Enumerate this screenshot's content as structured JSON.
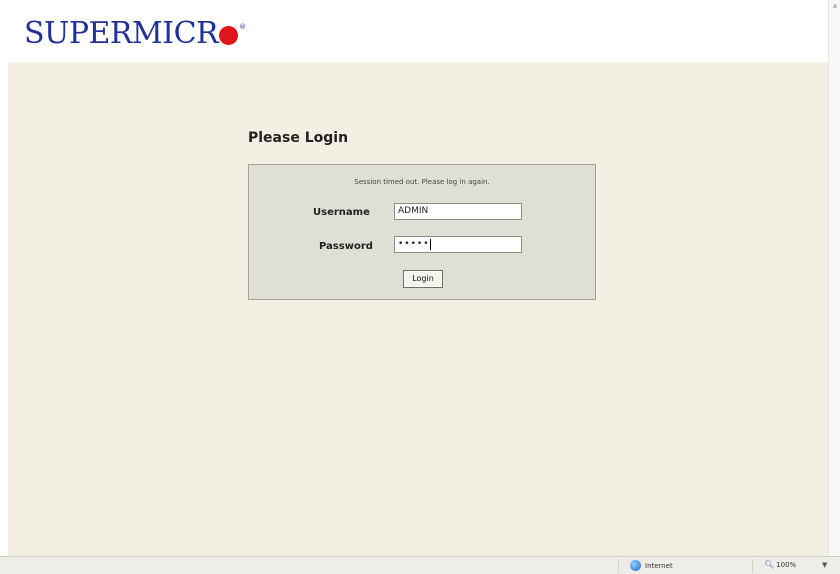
{
  "brand": {
    "logo_text": "SUPERMICR",
    "logo_reg": "®"
  },
  "login": {
    "title": "Please Login",
    "session_message": "Session timed out. Please log in again.",
    "username_label": "Username",
    "username_value": "ADMIN",
    "password_label": "Password",
    "password_value": "•••••",
    "button_label": "Login"
  },
  "statusbar": {
    "zone": "Internet",
    "zoom": "100%"
  },
  "colors": {
    "logo_blue": "#21309a",
    "logo_red": "#e0151b",
    "content_bg": "#f3f0e3",
    "login_box_bg": "#e0dfd6"
  }
}
